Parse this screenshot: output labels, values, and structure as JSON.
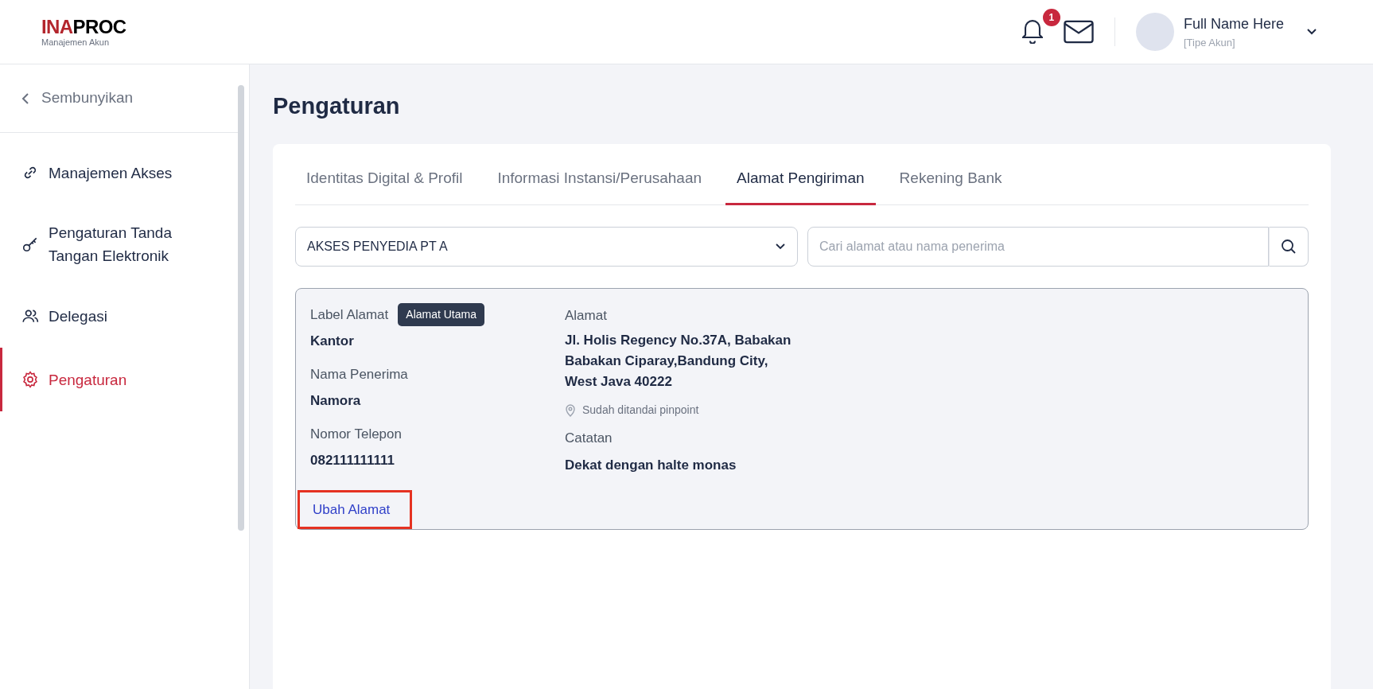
{
  "header": {
    "logo": {
      "part_1": "INA",
      "part_2": "PROC",
      "subtitle": "Manajemen Akun"
    },
    "notification_count": "1",
    "user": {
      "name": "Full Name Here",
      "type": "[Tipe Akun]"
    }
  },
  "sidebar": {
    "collapse_label": "Sembunyikan",
    "items": [
      {
        "label": "Manajemen Akses",
        "kind": "link",
        "selected": false
      },
      {
        "label": "Pengaturan Tanda Tangan Elektronik",
        "kind": "key",
        "selected": false
      },
      {
        "label": "Delegasi",
        "kind": "users",
        "selected": false
      },
      {
        "label": "Pengaturan",
        "kind": "gear",
        "selected": true
      }
    ]
  },
  "page_title": "Pengaturan",
  "tabs": [
    {
      "label": "Identitas Digital & Profil",
      "selected": false
    },
    {
      "label": "Informasi Instansi/Perusahaan",
      "selected": false
    },
    {
      "label": "Alamat Pengiriman",
      "selected": true
    },
    {
      "label": "Rekening Bank",
      "selected": false
    }
  ],
  "filter": {
    "dropdown_value": "AKSES PENYEDIA PT A",
    "search_placeholder": "Cari alamat atau nama penerima"
  },
  "address_card": {
    "label_title": "Label Alamat",
    "badge": "Alamat Utama",
    "label_value": "Kantor",
    "recipient_title": "Nama Penerima",
    "recipient_value": "Namora",
    "phone_title": "Nomor Telepon",
    "phone_value": "082111111111",
    "address_title": "Alamat",
    "address_value": "Jl. Holis Regency No.37A, Babakan Babakan Ciparay,Bandung City, West Java 40222",
    "pinpoint": "Sudah ditandai pinpoint",
    "note_title": "Catatan",
    "note_value": "Dekat dengan halte monas",
    "edit_link": "Ubah Alamat",
    "edit_link_highlighted": true
  }
}
